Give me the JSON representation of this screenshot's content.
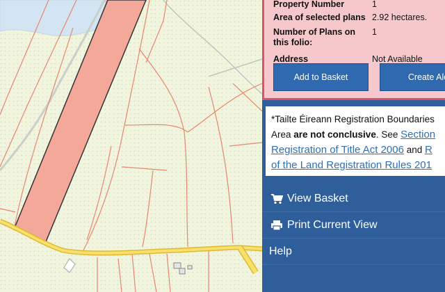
{
  "plan_info": {
    "rows": [
      {
        "label": "Property Number",
        "value": "1"
      },
      {
        "label": "Area of selected plans",
        "value": "2.92 hectares."
      },
      {
        "label": "Number of Plans on this folio:",
        "value": "1"
      },
      {
        "label": "Address",
        "value": "Not Available"
      }
    ],
    "add_to_basket_label": "Add to Basket",
    "create_alert_label": "Create Ale"
  },
  "disclaimer": {
    "line1": "*Tailte Éireann Registration Boundaries",
    "line2_prefix": "Area ",
    "line2_bold": "are not conclusive",
    "line2_suffix": ". See ",
    "link1": "Section",
    "link2": "Registration of Title Act 2006",
    "and": " and ",
    "link3": "R",
    "link4": "of the Land Registration Rules 201"
  },
  "menu": {
    "view_basket": "View Basket",
    "print_view": "Print Current View",
    "help": "Help"
  },
  "colors": {
    "panel_bg": "#2f5f9b",
    "info_bg": "#f6c8cc",
    "info_border": "#d9536b",
    "selected_plot": "#f4a89a",
    "road": "#f2d64a"
  },
  "icons": {
    "basket": "shopping-cart-icon",
    "print": "print-icon"
  }
}
